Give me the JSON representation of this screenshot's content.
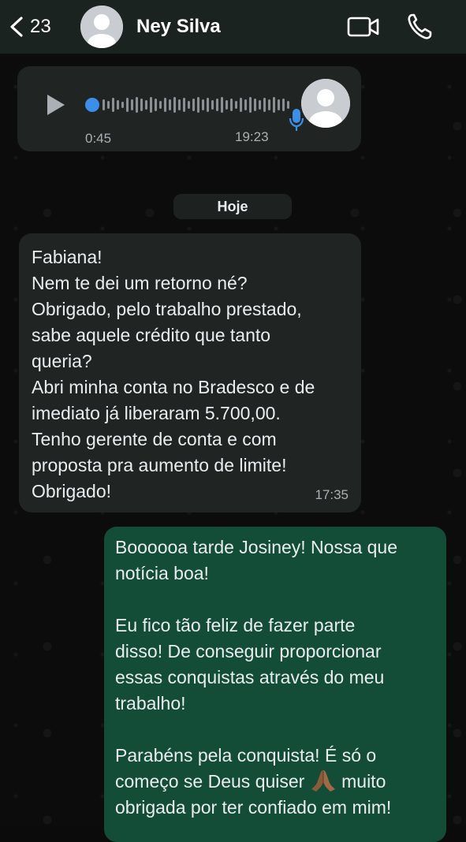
{
  "header": {
    "back_count": "23",
    "contact_name": "Ney Silva",
    "icons": [
      "back-chevron-icon",
      "avatar-icon",
      "video-call-icon",
      "phone-call-icon"
    ]
  },
  "voice_message": {
    "duration": "0:45",
    "time": "19:23",
    "icons": [
      "play-icon",
      "microphone-icon"
    ]
  },
  "date_chip": "Hoje",
  "incoming_message": {
    "lines": [
      "Fabiana!",
      "Nem te dei um retorno né?",
      "Obrigado, pelo trabalho prestado,",
      "sabe aquele crédito que tanto",
      "queria?",
      "Abri minha conta no Bradesco e de",
      "imediato já liberaram 5.700,00.",
      "Tenho gerente de conta e com",
      "proposta pra aumento de limite!",
      "Obrigado!"
    ],
    "time": "17:35"
  },
  "outgoing_message": {
    "p1": [
      "Boooooa tarde Josiney! Nossa que",
      "notícia boa!"
    ],
    "p2": [
      "Eu fico tão feliz de fazer parte",
      "disso! De conseguir proporcionar",
      "essas conquistas através do meu",
      "trabalho!"
    ],
    "p3": [
      "Parabéns pela conquista! É só o",
      "começo se Deus quiser",
      "muito",
      "obrigada por ter confiado em mim!"
    ],
    "emoji": "praying-hands-emoji"
  },
  "colors": {
    "header_bg": "#1b2321",
    "incoming_bubble": "#202524",
    "outgoing_bubble": "#134d37",
    "accent_blue": "#3b8fe8"
  }
}
